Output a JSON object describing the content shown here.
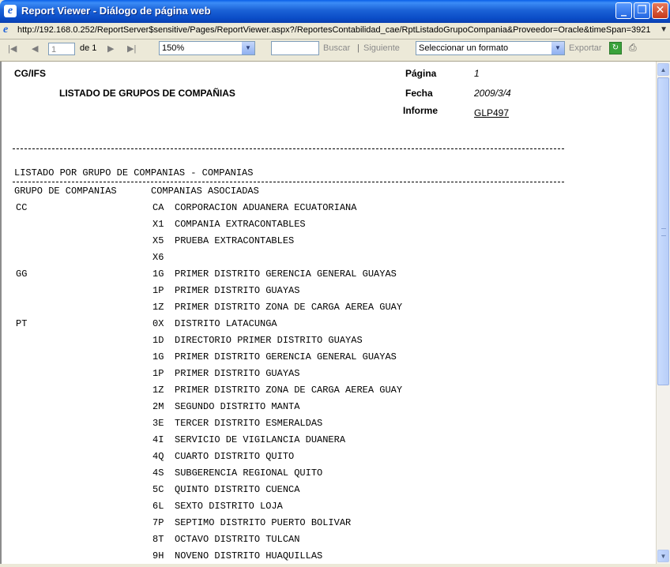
{
  "window": {
    "title": "Report Viewer - Diálogo de página web",
    "url": "http://192.168.0.252/ReportServer$sensitive/Pages/ReportViewer.aspx?/ReportesContabilidad_cae/RptListadoGrupoCompania&Proveedor=Oracle&timeSpan=3921"
  },
  "toolbar": {
    "page_value": "1",
    "page_of": "de 1",
    "zoom": "150%",
    "find_label": "Buscar",
    "separator": "|",
    "next_label": "Siguiente",
    "format_select": "Seleccionar un formato",
    "export_label": "Exportar"
  },
  "report": {
    "company": "CG/IFS",
    "title": "LISTADO DE GRUPOS DE COMPAÑIAS",
    "page_label": "Página",
    "page_value": "1",
    "date_label": "Fecha",
    "date_value": "2009/3/4",
    "report_label": "Informe",
    "report_value": "GLP497",
    "section_title": "LISTADO POR GRUPO DE COMPANIAS - COMPANIAS",
    "col_group": "GRUPO DE COMPANIAS",
    "col_companies": "COMPANIAS ASOCIADAS",
    "rows": [
      {
        "group": "CC",
        "code": "CA",
        "name": "CORPORACION ADUANERA ECUATORIANA"
      },
      {
        "group": "",
        "code": "X1",
        "name": "COMPANIA EXTRACONTABLES"
      },
      {
        "group": "",
        "code": "X5",
        "name": "PRUEBA EXTRACONTABLES"
      },
      {
        "group": "",
        "code": "X6",
        "name": ""
      },
      {
        "group": "GG",
        "code": "1G",
        "name": "PRIMER DISTRITO GERENCIA GENERAL GUAYAS"
      },
      {
        "group": "",
        "code": "1P",
        "name": "PRIMER DISTRITO GUAYAS"
      },
      {
        "group": "",
        "code": "1Z",
        "name": "PRIMER DISTRITO ZONA DE CARGA AEREA GUAY"
      },
      {
        "group": "PT",
        "code": "0X",
        "name": "DISTRITO LATACUNGA"
      },
      {
        "group": "",
        "code": "1D",
        "name": "DIRECTORIO PRIMER DISTRITO GUAYAS"
      },
      {
        "group": "",
        "code": "1G",
        "name": "PRIMER DISTRITO GERENCIA GENERAL GUAYAS"
      },
      {
        "group": "",
        "code": "1P",
        "name": "PRIMER DISTRITO GUAYAS"
      },
      {
        "group": "",
        "code": "1Z",
        "name": "PRIMER DISTRITO ZONA DE CARGA AEREA GUAY"
      },
      {
        "group": "",
        "code": "2M",
        "name": "SEGUNDO DISTRITO MANTA"
      },
      {
        "group": "",
        "code": "3E",
        "name": "TERCER DISTRITO ESMERALDAS"
      },
      {
        "group": "",
        "code": "4I",
        "name": "SERVICIO DE VIGILANCIA DUANERA"
      },
      {
        "group": "",
        "code": "4Q",
        "name": "CUARTO DISTRITO QUITO"
      },
      {
        "group": "",
        "code": "4S",
        "name": "SUBGERENCIA REGIONAL QUITO"
      },
      {
        "group": "",
        "code": "5C",
        "name": "QUINTO DISTRITO CUENCA"
      },
      {
        "group": "",
        "code": "6L",
        "name": "SEXTO DISTRITO LOJA"
      },
      {
        "group": "",
        "code": "7P",
        "name": "SEPTIMO DISTRITO PUERTO BOLIVAR"
      },
      {
        "group": "",
        "code": "8T",
        "name": "OCTAVO DISTRITO TULCAN"
      },
      {
        "group": "",
        "code": "9H",
        "name": "NOVENO DISTRITO HUAQUILLAS"
      }
    ]
  }
}
